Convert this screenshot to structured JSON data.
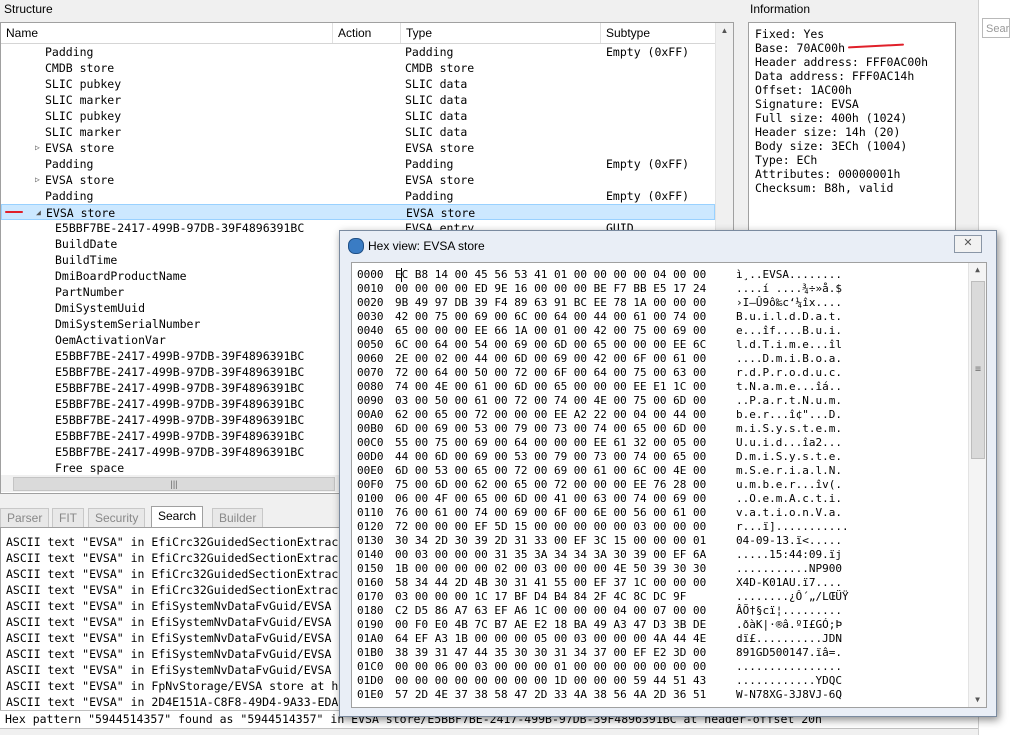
{
  "structure": {
    "title": "Structure",
    "columns": [
      "Name",
      "Action",
      "Type",
      "Subtype"
    ],
    "rows": [
      {
        "name": "Padding",
        "indent": 1,
        "action": "",
        "type": "Padding",
        "subtype": "Empty (0xFF)"
      },
      {
        "name": "CMDB store",
        "indent": 1,
        "action": "",
        "type": "CMDB store",
        "subtype": ""
      },
      {
        "name": "SLIC pubkey",
        "indent": 1,
        "action": "",
        "type": "SLIC data",
        "subtype": ""
      },
      {
        "name": "SLIC marker",
        "indent": 1,
        "action": "",
        "type": "SLIC data",
        "subtype": ""
      },
      {
        "name": "SLIC pubkey",
        "indent": 1,
        "action": "",
        "type": "SLIC data",
        "subtype": ""
      },
      {
        "name": "SLIC marker",
        "indent": 1,
        "action": "",
        "type": "SLIC data",
        "subtype": ""
      },
      {
        "name": "EVSA store",
        "indent": 1,
        "expander": "▷",
        "action": "",
        "type": "EVSA store",
        "subtype": ""
      },
      {
        "name": "Padding",
        "indent": 1,
        "action": "",
        "type": "Padding",
        "subtype": "Empty (0xFF)"
      },
      {
        "name": "EVSA store",
        "indent": 1,
        "expander": "▷",
        "action": "",
        "type": "EVSA store",
        "subtype": ""
      },
      {
        "name": "Padding",
        "indent": 1,
        "action": "",
        "type": "Padding",
        "subtype": "Empty (0xFF)"
      },
      {
        "name": "EVSA store",
        "indent": 1,
        "expander": "◢",
        "action": "",
        "type": "EVSA store",
        "subtype": "",
        "selected": true
      },
      {
        "name": "E5BBF7BE-2417-499B-97DB-39F4896391BC",
        "indent": 2,
        "action": "",
        "type": "EVSA entry",
        "subtype": "GUID"
      },
      {
        "name": "BuildDate",
        "indent": 2,
        "action": "",
        "type": "",
        "subtype": ""
      },
      {
        "name": "BuildTime",
        "indent": 2,
        "action": "",
        "type": "",
        "subtype": ""
      },
      {
        "name": "DmiBoardProductName",
        "indent": 2,
        "action": "",
        "type": "",
        "subtype": ""
      },
      {
        "name": "PartNumber",
        "indent": 2,
        "action": "",
        "type": "",
        "subtype": ""
      },
      {
        "name": "DmiSystemUuid",
        "indent": 2,
        "action": "",
        "type": "",
        "subtype": ""
      },
      {
        "name": "DmiSystemSerialNumber",
        "indent": 2,
        "action": "",
        "type": "",
        "subtype": ""
      },
      {
        "name": "OemActivationVar",
        "indent": 2,
        "action": "",
        "type": "",
        "subtype": ""
      },
      {
        "name": "E5BBF7BE-2417-499B-97DB-39F4896391BC",
        "indent": 2,
        "action": "",
        "type": "",
        "subtype": ""
      },
      {
        "name": "E5BBF7BE-2417-499B-97DB-39F4896391BC",
        "indent": 2,
        "action": "",
        "type": "",
        "subtype": ""
      },
      {
        "name": "E5BBF7BE-2417-499B-97DB-39F4896391BC",
        "indent": 2,
        "action": "",
        "type": "",
        "subtype": ""
      },
      {
        "name": "E5BBF7BE-2417-499B-97DB-39F4896391BC",
        "indent": 2,
        "action": "",
        "type": "",
        "subtype": ""
      },
      {
        "name": "E5BBF7BE-2417-499B-97DB-39F4896391BC",
        "indent": 2,
        "action": "",
        "type": "",
        "subtype": ""
      },
      {
        "name": "E5BBF7BE-2417-499B-97DB-39F4896391BC",
        "indent": 2,
        "action": "",
        "type": "",
        "subtype": ""
      },
      {
        "name": "E5BBF7BE-2417-499B-97DB-39F4896391BC",
        "indent": 2,
        "action": "",
        "type": "",
        "subtype": ""
      },
      {
        "name": "Free space",
        "indent": 2,
        "action": "",
        "type": "",
        "subtype": ""
      }
    ],
    "scroll_up_icon": "▲",
    "scroll_grip_icon": "|||"
  },
  "information": {
    "title": "Information",
    "lines": [
      "Fixed: Yes",
      "Base: 70AC00h",
      "Header address: FFF0AC00h",
      "Data address: FFF0AC14h",
      "Offset: 1AC00h",
      "Signature: EVSA",
      "Full size: 400h (1024)",
      "Header size: 14h (20)",
      "Body size: 3ECh (1004)",
      "Type: ECh",
      "Attributes: 00000001h",
      "Checksum: B8h, valid"
    ],
    "search_placeholder": "Sear"
  },
  "tabs": [
    {
      "label": "Parser",
      "active": false,
      "enabled": true
    },
    {
      "label": "FIT",
      "active": false,
      "enabled": false
    },
    {
      "label": "Security",
      "active": false,
      "enabled": false
    },
    {
      "label": "Search",
      "active": true,
      "enabled": true
    },
    {
      "label": "Builder",
      "active": false,
      "enabled": false
    }
  ],
  "search_results": [
    "ASCII text \"EVSA\" in EfiCrc32GuidedSectionExtrac",
    "ASCII text \"EVSA\" in EfiCrc32GuidedSectionExtrac",
    "ASCII text \"EVSA\" in EfiCrc32GuidedSectionExtrac",
    "ASCII text \"EVSA\" in EfiCrc32GuidedSectionExtrac",
    "ASCII text \"EVSA\" in EfiSystemNvDataFvGuid/EVSA",
    "ASCII text \"EVSA\" in EfiSystemNvDataFvGuid/EVSA",
    "ASCII text \"EVSA\" in EfiSystemNvDataFvGuid/EVSA",
    "ASCII text \"EVSA\" in EfiSystemNvDataFvGuid/EVSA",
    "ASCII text \"EVSA\" in EfiSystemNvDataFvGuid/EVSA",
    "ASCII text \"EVSA\" in FpNvStorage/EVSA store at h",
    "ASCII text \"EVSA\" in 2D4E151A-C8F8-49D4-9A33-EDA"
  ],
  "status_line": "Hex pattern \"5944514357\" found as \"5944514357\" in EVSA store/E5BBF7BE-2417-499B-97DB-39F4896391BC at header-offset 20h",
  "hex_view": {
    "title": "Hex view: EVSA store",
    "close_icon": "✕",
    "lines": [
      {
        "off": "0000",
        "bytes": "EC B8 14 00 45 56 53 41 01 00 00 00 00 04 00 00",
        "ascii": "ì¸..EVSA........"
      },
      {
        "off": "0010",
        "bytes": "00 00 00 00 ED 9E 16 00 00 00 BE F7 BB E5 17 24",
        "ascii": "....í ....¾÷»å.$"
      },
      {
        "off": "0020",
        "bytes": "9B 49 97 DB 39 F4 89 63 91 BC EE 78 1A 00 00 00",
        "ascii": "›I—Û9ô‰c‘¼îx...."
      },
      {
        "off": "0030",
        "bytes": "42 00 75 00 69 00 6C 00 64 00 44 00 61 00 74 00",
        "ascii": "B.u.i.l.d.D.a.t."
      },
      {
        "off": "0040",
        "bytes": "65 00 00 00 EE 66 1A 00 01 00 42 00 75 00 69 00",
        "ascii": "e...îf....B.u.i."
      },
      {
        "off": "0050",
        "bytes": "6C 00 64 00 54 00 69 00 6D 00 65 00 00 00 EE 6C",
        "ascii": "l.d.T.i.m.e...îl"
      },
      {
        "off": "0060",
        "bytes": "2E 00 02 00 44 00 6D 00 69 00 42 00 6F 00 61 00",
        "ascii": "....D.m.i.B.o.a."
      },
      {
        "off": "0070",
        "bytes": "72 00 64 00 50 00 72 00 6F 00 64 00 75 00 63 00",
        "ascii": "r.d.P.r.o.d.u.c."
      },
      {
        "off": "0080",
        "bytes": "74 00 4E 00 61 00 6D 00 65 00 00 00 EE E1 1C 00",
        "ascii": "t.N.a.m.e...îá.."
      },
      {
        "off": "0090",
        "bytes": "03 00 50 00 61 00 72 00 74 00 4E 00 75 00 6D 00",
        "ascii": "..P.a.r.t.N.u.m."
      },
      {
        "off": "00A0",
        "bytes": "62 00 65 00 72 00 00 00 EE A2 22 00 04 00 44 00",
        "ascii": "b.e.r...î¢\"...D."
      },
      {
        "off": "00B0",
        "bytes": "6D 00 69 00 53 00 79 00 73 00 74 00 65 00 6D 00",
        "ascii": "m.i.S.y.s.t.e.m."
      },
      {
        "off": "00C0",
        "bytes": "55 00 75 00 69 00 64 00 00 00 EE 61 32 00 05 00",
        "ascii": "U.u.i.d...îa2..."
      },
      {
        "off": "00D0",
        "bytes": "44 00 6D 00 69 00 53 00 79 00 73 00 74 00 65 00",
        "ascii": "D.m.i.S.y.s.t.e."
      },
      {
        "off": "00E0",
        "bytes": "6D 00 53 00 65 00 72 00 69 00 61 00 6C 00 4E 00",
        "ascii": "m.S.e.r.i.a.l.N."
      },
      {
        "off": "00F0",
        "bytes": "75 00 6D 00 62 00 65 00 72 00 00 00 EE 76 28 00",
        "ascii": "u.m.b.e.r...îv(."
      },
      {
        "off": "0100",
        "bytes": "06 00 4F 00 65 00 6D 00 41 00 63 00 74 00 69 00",
        "ascii": "..O.e.m.A.c.t.i."
      },
      {
        "off": "0110",
        "bytes": "76 00 61 00 74 00 69 00 6F 00 6E 00 56 00 61 00",
        "ascii": "v.a.t.i.o.n.V.a."
      },
      {
        "off": "0120",
        "bytes": "72 00 00 00 EF 5D 15 00 00 00 00 00 03 00 00 00",
        "ascii": "r...ï]..........."
      },
      {
        "off": "0130",
        "bytes": "30 34 2D 30 39 2D 31 33 00 EF 3C 15 00 00 00 01",
        "ascii": "04-09-13.ï<....."
      },
      {
        "off": "0140",
        "bytes": "00 03 00 00 00 31 35 3A 34 34 3A 30 39 00 EF 6A",
        "ascii": ".....15:44:09.ïj"
      },
      {
        "off": "0150",
        "bytes": "1B 00 00 00 00 02 00 03 00 00 00 4E 50 39 30 30",
        "ascii": "...........NP900"
      },
      {
        "off": "0160",
        "bytes": "58 34 44 2D 4B 30 31 41 55 00 EF 37 1C 00 00 00",
        "ascii": "X4D-K01AU.ï7...."
      },
      {
        "off": "0170",
        "bytes": "03 00 00 00 1C 17 BF D4 B4 84 2F 4C 8C DC 9F",
        "ascii": "........¿Ô´„/LŒÜŸ"
      },
      {
        "off": "0180",
        "bytes": "C2 D5 86 A7 63 EF A6 1C 00 00 00 04 00 07 00 00",
        "ascii": "ÂÕ†§cï¦........."
      },
      {
        "off": "0190",
        "bytes": "00 F0 E0 4B 7C B7 AE E2 18 BA 49 A3 47 D3 3B DE",
        "ascii": ".ðàK|·®â.ºI£GÓ;Þ"
      },
      {
        "off": "01A0",
        "bytes": "64 EF A3 1B 00 00 00 05 00 03 00 00 00 4A 44 4E",
        "ascii": "dï£..........JDN"
      },
      {
        "off": "01B0",
        "bytes": "38 39 31 47 44 35 30 30 31 34 37 00 EF E2 3D 00",
        "ascii": "891GD500147.ïâ=."
      },
      {
        "off": "01C0",
        "bytes": "00 00 06 00 03 00 00 00 01 00 00 00 00 00 00 00",
        "ascii": "................"
      },
      {
        "off": "01D0",
        "bytes": "00 00 00 00 00 00 00 00 1D 00 00 00 59 44 51 43",
        "ascii": "............YDQC"
      },
      {
        "off": "01E0",
        "bytes": "57 2D 4E 37 38 58 47 2D 33 4A 38 56 4A 2D 36 51",
        "ascii": "W-N78XG-3J8VJ-6Q"
      }
    ],
    "scroll_up_icon": "▲",
    "scroll_down_icon": "▼",
    "scroll_grip_icon": "≡"
  },
  "annotation_color": "#e0202a"
}
